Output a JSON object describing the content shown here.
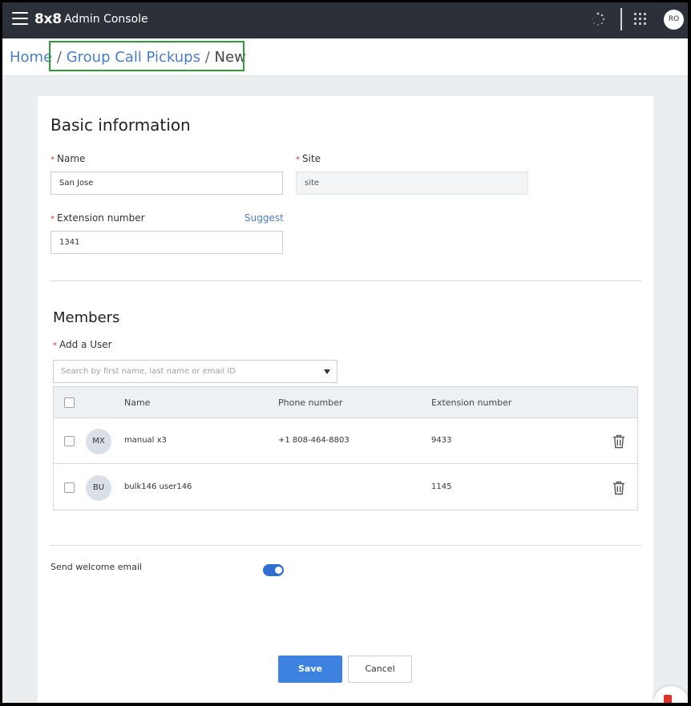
{
  "topbar": {
    "logo": "8x8",
    "app_title": "Admin Console",
    "avatar_initials": "RO"
  },
  "breadcrumb": {
    "home": "Home",
    "sep1": "/",
    "section": "Group Call Pickups",
    "sep2": "/",
    "current": "New"
  },
  "basic": {
    "heading": "Basic information",
    "name_label": "Name",
    "name_value": "San Jose",
    "site_label": "Site",
    "site_value": "site",
    "extension_label": "Extension number",
    "extension_value": "1341",
    "suggest_label": "Suggest",
    "required_mark": "*"
  },
  "members": {
    "heading": "Members",
    "add_user_label": "Add a User",
    "search_placeholder": "Search by first name, last name or email ID",
    "columns": [
      "Name",
      "Phone number",
      "Extension number"
    ],
    "rows": [
      {
        "initials": "MX",
        "name": "manual x3",
        "phone": "+1 808-464-8803",
        "extension": "9433"
      },
      {
        "initials": "BU",
        "name": "bulk146 user146",
        "phone": "",
        "extension": "1145"
      }
    ]
  },
  "welcome": {
    "label": "Send welcome email",
    "enabled": true
  },
  "actions": {
    "save_label": "Save",
    "cancel_label": "Cancel"
  },
  "colors": {
    "topbar": "#2b3039",
    "link": "#4a7ec2",
    "primary": "#3d82de",
    "required": "#d9392e",
    "highlight": "#2e9a3a"
  }
}
